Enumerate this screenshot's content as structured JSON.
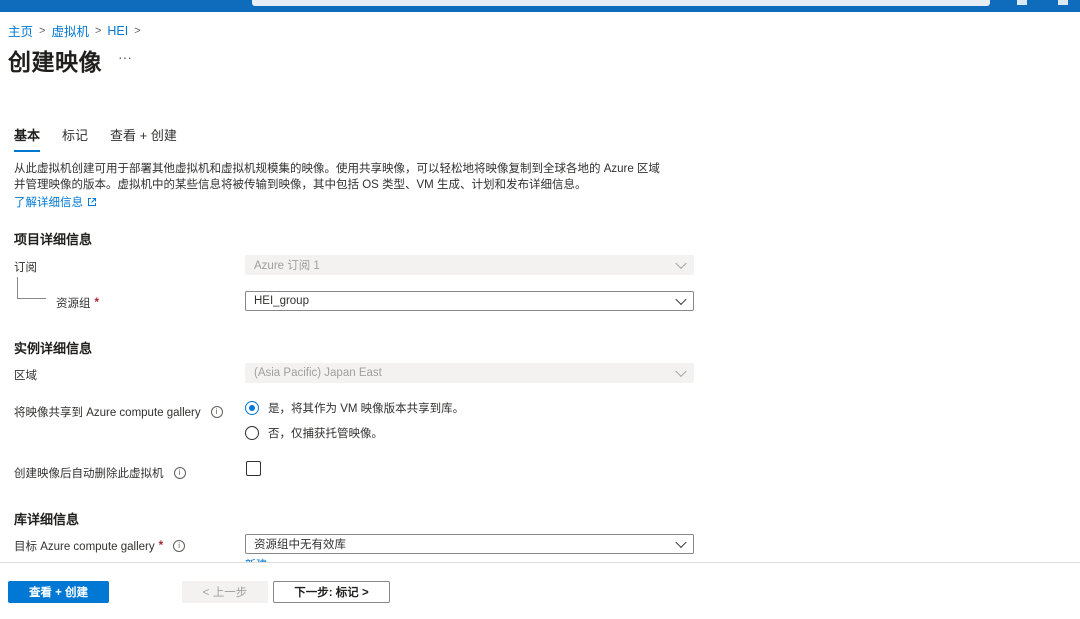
{
  "breadcrumb": [
    {
      "label": "主页"
    },
    {
      "label": "虚拟机"
    },
    {
      "label": "HEI"
    }
  ],
  "breadcrumb_separator": ">",
  "page_title": "创建映像",
  "more_label": "···",
  "tabs": [
    {
      "label": "基本",
      "active": true
    },
    {
      "label": "标记",
      "active": false
    },
    {
      "label": "查看 + 创建",
      "active": false
    }
  ],
  "description": {
    "line1": "从此虚拟机创建可用于部署其他虚拟机和虚拟机规模集的映像。使用共享映像，可以轻松地将映像复制到全球各地的 Azure 区域",
    "line2": "并管理映像的版本。虚拟机中的某些信息将被传输到映像，其中包括 OS 类型、VM 生成、计划和发布详细信息。",
    "learn_more": "了解详细信息"
  },
  "project": {
    "heading": "项目详细信息",
    "subscription_label": "订阅",
    "subscription_value": "Azure 订阅 1",
    "resource_group_label": "资源组",
    "resource_group_value": "HEI_group"
  },
  "instance": {
    "heading": "实例详细信息",
    "region_label": "区域",
    "region_value": "(Asia Pacific) Japan East",
    "share_label": "将映像共享到 Azure compute gallery",
    "share_options": [
      {
        "label": "是，将其作为 VM 映像版本共享到库。",
        "checked": true
      },
      {
        "label": "否，仅捕获托管映像。",
        "checked": false
      }
    ],
    "auto_delete_label": "创建映像后自动删除此虚拟机",
    "auto_delete_checked": false
  },
  "gallery": {
    "heading": "库详细信息",
    "target_label": "目标 Azure compute gallery",
    "target_value": "资源组中无有效库",
    "new_link": "新建"
  },
  "footer": {
    "review_create": "查看 + 创建",
    "previous": "< 上一步",
    "next": "下一步: 标记 >"
  },
  "icons": {
    "info": "info-icon",
    "external_link": "external-link-icon",
    "chevron": "chevron-down-icon"
  },
  "colors": {
    "accent": "#0078d4",
    "topbar": "#0f6cbd",
    "required": "#a4262c"
  }
}
